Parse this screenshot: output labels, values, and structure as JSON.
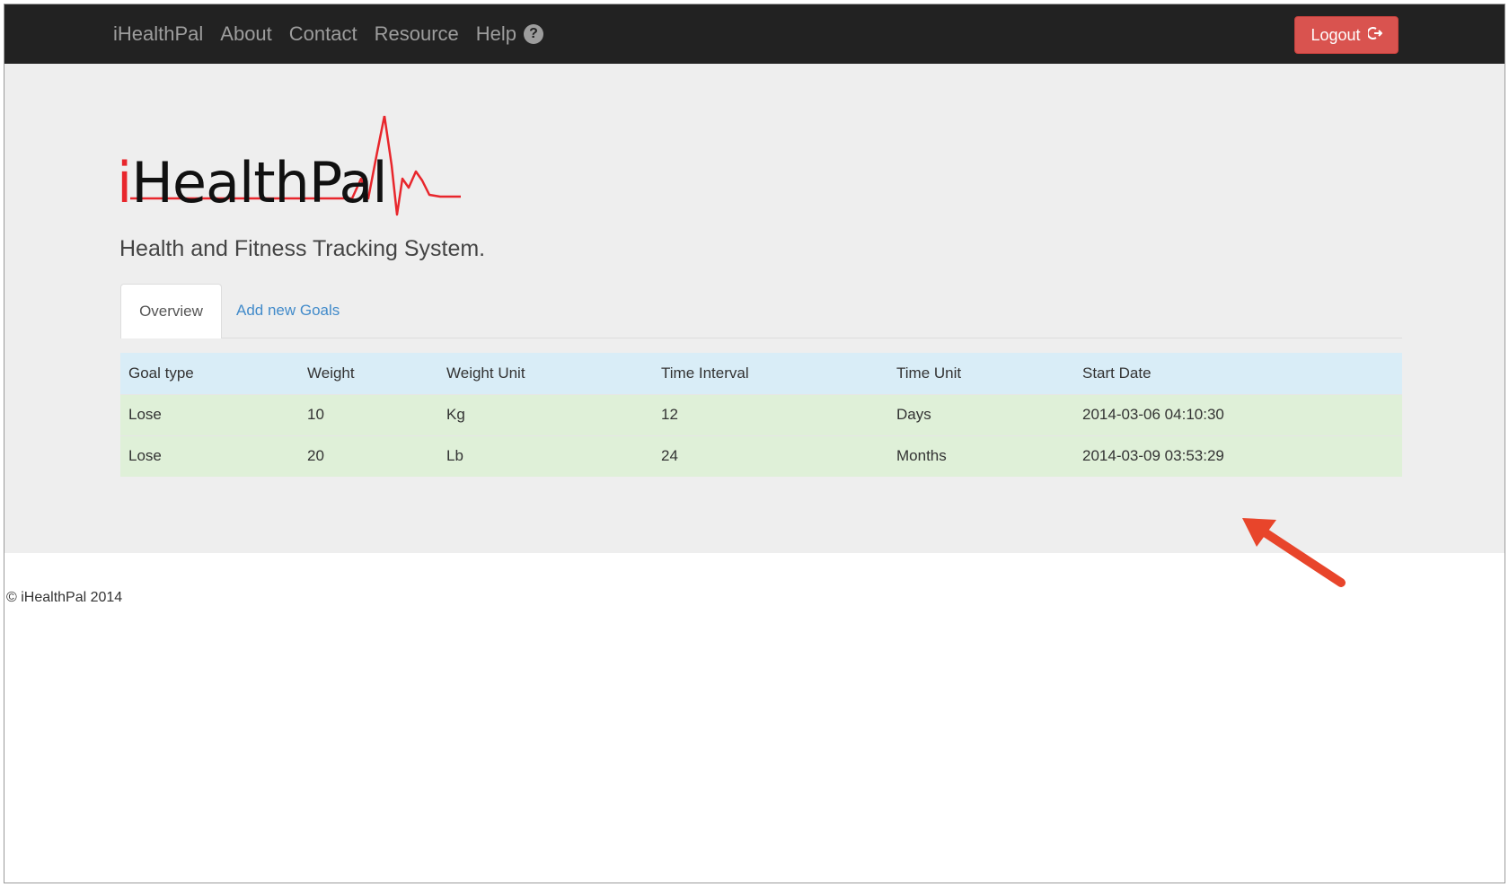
{
  "navbar": {
    "brand": "iHealthPal",
    "links": [
      "About",
      "Contact",
      "Resource",
      "Help"
    ],
    "help_icon": "question-circle-icon",
    "logout_label": "Logout",
    "logout_icon": "logout-icon",
    "logout_color": "#d9534f"
  },
  "hero": {
    "logo_text_prefix": "i",
    "logo_text_rest": "HealthPal",
    "logo_accent": "#e8262c",
    "tagline": "Health and Fitness Tracking System."
  },
  "tabs": [
    {
      "label": "Overview",
      "active": true
    },
    {
      "label": "Add new Goals",
      "active": false
    }
  ],
  "table": {
    "headers": [
      "Goal type",
      "Weight",
      "Weight Unit",
      "Time Interval",
      "Time Unit",
      "Start Date"
    ],
    "rows": [
      [
        "Lose",
        "10",
        "Kg",
        "12",
        "Days",
        "2014-03-06 04:10:30"
      ],
      [
        "Lose",
        "20",
        "Lb",
        "24",
        "Months",
        "2014-03-09 03:53:29"
      ]
    ]
  },
  "annotation": {
    "arrow_color": "#e8452b"
  },
  "footer": {
    "copyright": "© iHealthPal 2014"
  }
}
